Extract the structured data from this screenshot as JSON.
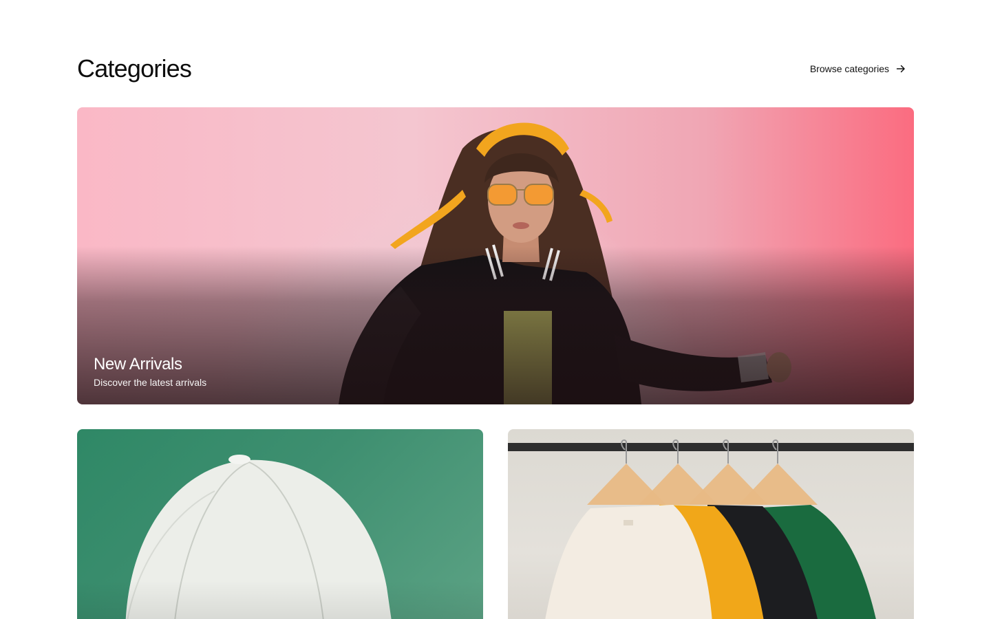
{
  "header": {
    "title": "Categories",
    "browse_label": "Browse categories",
    "browse_icon": "arrow-right-icon"
  },
  "categories": [
    {
      "title": "New Arrivals",
      "subtitle": "Discover the latest arrivals",
      "image": "woman-in-varsity-jacket-with-orange-sunglasses",
      "accent": "#fb6c80"
    },
    {
      "title": "",
      "subtitle": "",
      "image": "white-baseball-cap-on-green-background",
      "accent": "#3e8f70"
    },
    {
      "title": "",
      "subtitle": "",
      "image": "t-shirts-on-wooden-hangers",
      "accent": "#dcd9d2"
    }
  ]
}
